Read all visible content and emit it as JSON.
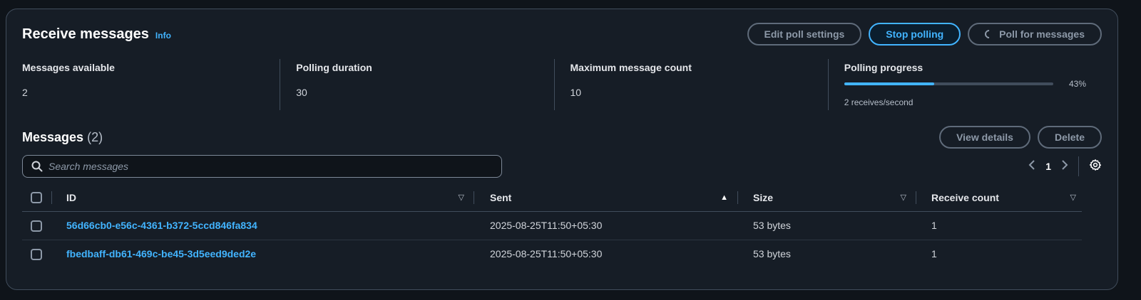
{
  "header": {
    "title": "Receive messages",
    "info_label": "Info",
    "buttons": {
      "edit_poll": "Edit poll settings",
      "stop_polling": "Stop polling",
      "poll_messages": "Poll for messages"
    }
  },
  "stats": {
    "messages_available": {
      "label": "Messages available",
      "value": "2"
    },
    "polling_duration": {
      "label": "Polling duration",
      "value": "30"
    },
    "max_message_count": {
      "label": "Maximum message count",
      "value": "10"
    },
    "polling_progress": {
      "label": "Polling progress",
      "percent": "43%",
      "progress": 43,
      "rate": "2 receives/second"
    }
  },
  "messages": {
    "title": "Messages",
    "count": "(2)",
    "view_details": "View details",
    "delete": "Delete",
    "search_placeholder": "Search messages",
    "pagination": {
      "current_page": "1"
    },
    "columns": {
      "id": "ID",
      "sent": "Sent",
      "size": "Size",
      "receive_count": "Receive count"
    },
    "rows": [
      {
        "id": "56d66cb0-e56c-4361-b372-5ccd846fa834",
        "sent": "2025-08-25T11:50+05:30",
        "size": "53 bytes",
        "receive_count": "1"
      },
      {
        "id": "fbedbaff-db61-469c-be45-3d5eed9ded2e",
        "sent": "2025-08-25T11:50+05:30",
        "size": "53 bytes",
        "receive_count": "1"
      }
    ]
  },
  "colors": {
    "accent": "#42b4ff",
    "panel_bg": "#161d26",
    "border": "#414d5c"
  }
}
